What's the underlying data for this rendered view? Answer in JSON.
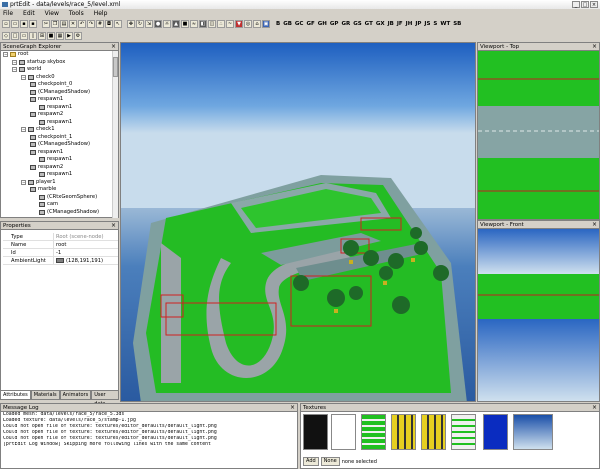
{
  "window": {
    "title": "prtEdit - data/levels/race_5/level.xml"
  },
  "menu": [
    "File",
    "Edit",
    "View",
    "Tools",
    "Help"
  ],
  "toolbar_tags": [
    "B",
    "GB",
    "GC",
    "GF",
    "GH",
    "GP",
    "GR",
    "GS",
    "GT",
    "GX",
    "JB",
    "JF",
    "JH",
    "JP",
    "JS",
    "S",
    "WT",
    "SB"
  ],
  "scenegraph": {
    "title": "SceneGraph Explorer",
    "nodes": [
      {
        "label": "root",
        "icon": "folder-icon",
        "depth": 0
      },
      {
        "label": "startup skybox",
        "icon": "object-icon",
        "depth": 1
      },
      {
        "label": "world",
        "icon": "world-icon",
        "depth": 1
      },
      {
        "label": "check0",
        "icon": "group-icon",
        "depth": 2
      },
      {
        "label": "checkpoint_0",
        "icon": "checkpoint-icon",
        "depth": 3
      },
      {
        "label": "(CManagedShadow)",
        "icon": "object-icon",
        "depth": 3
      },
      {
        "label": "respawn1",
        "icon": "respawn-icon",
        "depth": 3
      },
      {
        "label": "respawn1",
        "icon": "respawn-icon",
        "depth": 4
      },
      {
        "label": "respawn2",
        "icon": "respawn-icon",
        "depth": 3
      },
      {
        "label": "respawn1",
        "icon": "respawn-icon",
        "depth": 4
      },
      {
        "label": "check1",
        "icon": "group-icon",
        "depth": 2
      },
      {
        "label": "checkpoint_1",
        "icon": "checkpoint-icon",
        "depth": 3
      },
      {
        "label": "(CManagedShadow)",
        "icon": "object-icon",
        "depth": 3
      },
      {
        "label": "respawn1",
        "icon": "respawn-icon",
        "depth": 3
      },
      {
        "label": "respawn1",
        "icon": "respawn-icon",
        "depth": 4
      },
      {
        "label": "respawn2",
        "icon": "respawn-icon",
        "depth": 3
      },
      {
        "label": "respawn1",
        "icon": "respawn-icon",
        "depth": 4
      },
      {
        "label": "player1",
        "icon": "player-icon",
        "depth": 2
      },
      {
        "label": "marble",
        "icon": "object-icon",
        "depth": 3
      },
      {
        "label": "(CRtxGeomSphere)",
        "icon": "object-icon",
        "depth": 4
      },
      {
        "label": "cam",
        "icon": "object-icon",
        "depth": 4
      },
      {
        "label": "(CManagedShadow)",
        "icon": "object-icon",
        "depth": 4
      }
    ]
  },
  "properties": {
    "title": "Properties",
    "rows": [
      {
        "key": "Type",
        "value": "Root (scene-node)"
      },
      {
        "key": "Name",
        "value": "root"
      },
      {
        "key": "Id",
        "value": "-1"
      },
      {
        "key": "AmbientLight",
        "value": "(128,191,191)"
      }
    ],
    "tabs": [
      "Attributes",
      "Materials",
      "Animators",
      "User data"
    ]
  },
  "viewports": {
    "top_title": "Viewport - Top",
    "front_title": "Viewport - Front"
  },
  "message_log": {
    "title": "Message Log",
    "lines": [
      "Loaded mesh: data/levels/race_5/race_5.3ds",
      "Loaded texture: data/levels/race_5/stamp-1.jpg",
      "Could not open file of texture: textures/editor_defaults/default_light.png",
      "Could not open file of texture: textures/editor_defaults/default_light.png",
      "Could not open file of texture: textures/editor_defaults/default_light.png",
      "[prtEdit Log Window] Skipping more following lines with the same content"
    ]
  },
  "textures": {
    "title": "Textures",
    "add_label": "Add",
    "none_label": "None",
    "status": "none selected"
  },
  "colors": {
    "grass": "#22c022",
    "wall": "#8aa6a6",
    "sky": "#4a8ed8",
    "sea": "#2a63a6"
  }
}
